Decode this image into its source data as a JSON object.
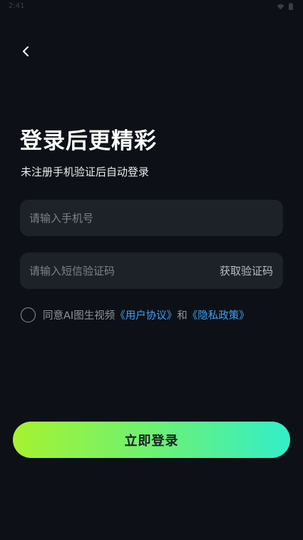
{
  "status_bar": {
    "time": "2:41",
    "icons": [
      "wifi-icon",
      "battery-icon"
    ]
  },
  "header": {
    "back_icon": "chevron-left-icon"
  },
  "title": "登录后更精彩",
  "subtitle": "未注册手机验证后自动登录",
  "phone_field": {
    "placeholder": "请输入手机号",
    "value": ""
  },
  "code_field": {
    "placeholder": "请输入短信验证码",
    "value": "",
    "get_code_label": "获取验证码"
  },
  "agreement": {
    "checked": false,
    "prefix": "同意AI图生视频",
    "user_agreement": "《用户协议》",
    "conjunction": "和",
    "privacy_policy": "《隐私政策》"
  },
  "login_button": {
    "label": "立即登录"
  },
  "colors": {
    "background": "#0d1117",
    "input_bg": "#1d2229",
    "link": "#3fa2f6",
    "gradient_start": "#a6f230",
    "gradient_end": "#33eec9"
  }
}
